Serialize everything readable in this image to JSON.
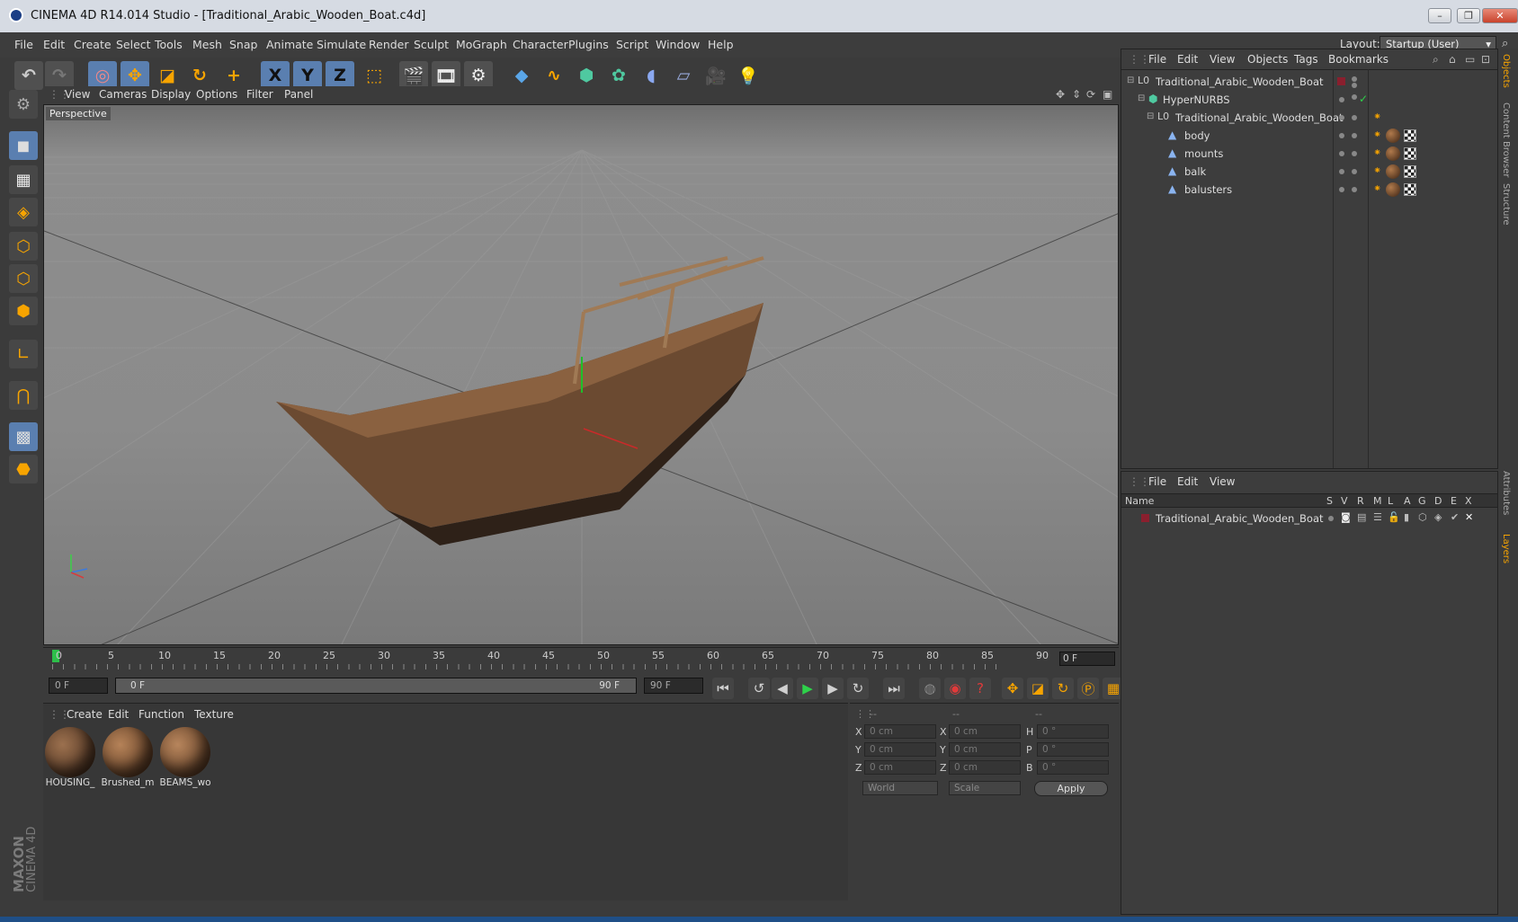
{
  "window": {
    "title": "CINEMA 4D R14.014 Studio - [Traditional_Arabic_Wooden_Boat.c4d]",
    "controls": {
      "minimize": "–",
      "restore": "❐",
      "close": "✕"
    }
  },
  "menubar": {
    "items": [
      "File",
      "Edit",
      "Create",
      "Select",
      "Tools",
      "Mesh",
      "Snap",
      "Animate",
      "Simulate",
      "Render",
      "Sculpt",
      "MoGraph",
      "Character",
      "Plugins",
      "Script",
      "Window",
      "Help"
    ],
    "layout_label": "Layout:",
    "layout_value": "Startup (User)"
  },
  "toolbar": {
    "icons": [
      "undo-icon",
      "redo-icon",
      "live-selection-icon",
      "move-icon",
      "scale-icon",
      "rotate-icon",
      "add-icon",
      "x-axis-icon",
      "y-axis-icon",
      "z-axis-icon",
      "world-coordinates-icon",
      "render-view-icon",
      "render-picture-viewer-icon",
      "edit-render-settings-icon",
      "cube-icon",
      "spline-icon",
      "nurbs-icon",
      "array-icon",
      "deformer-icon",
      "floor-icon",
      "camera-icon",
      "light-icon"
    ],
    "axis_labels": {
      "x": "X",
      "y": "Y",
      "z": "Z"
    }
  },
  "viewport": {
    "menu": [
      "View",
      "Cameras",
      "Display",
      "Options",
      "Filter",
      "Panel"
    ],
    "label": "Perspective"
  },
  "timeline": {
    "ticks": [
      "0",
      "5",
      "10",
      "15",
      "20",
      "25",
      "30",
      "35",
      "40",
      "45",
      "50",
      "55",
      "60",
      "65",
      "70",
      "75",
      "80",
      "85",
      "90"
    ],
    "current_frame": "0 F",
    "start_field": "0 F",
    "range_start": "0 F",
    "range_end": "90 F",
    "end_field": "90 F"
  },
  "material_manager": {
    "menu": [
      "Create",
      "Edit",
      "Function",
      "Texture"
    ],
    "materials": [
      {
        "name": "HOUSING_",
        "color": "#6b4a33"
      },
      {
        "name": "Brushed_m",
        "color": "#8a5a36"
      },
      {
        "name": "BEAMS_wo",
        "color": "#8d5d3a"
      }
    ]
  },
  "coordinates": {
    "headers": [
      "--",
      "--",
      "--"
    ],
    "rows": [
      {
        "l1": "X",
        "v1": "0 cm",
        "l2": "X",
        "v2": "0 cm",
        "l3": "H",
        "v3": "0 °"
      },
      {
        "l1": "Y",
        "v1": "0 cm",
        "l2": "Y",
        "v2": "0 cm",
        "l3": "P",
        "v3": "0 °"
      },
      {
        "l1": "Z",
        "v1": "0 cm",
        "l2": "Z",
        "v2": "0 cm",
        "l3": "B",
        "v3": "0 °"
      }
    ],
    "world": "World",
    "scale": "Scale",
    "apply": "Apply"
  },
  "object_manager": {
    "menu": [
      "File",
      "Edit",
      "View",
      "Objects",
      "Tags",
      "Bookmarks"
    ],
    "objects": [
      {
        "name": "Traditional_Arabic_Wooden_Boat",
        "icon": "null-object-icon",
        "tags": "layer"
      },
      {
        "name": "HyperNURBS",
        "icon": "hypernurbs-icon",
        "tags": "check"
      },
      {
        "name": "Traditional_Arabic_Wooden_Boat",
        "icon": "null-object-icon",
        "tags": "phong"
      },
      {
        "name": "body",
        "icon": "polygon-object-icon",
        "tags": "material"
      },
      {
        "name": "mounts",
        "icon": "polygon-object-icon",
        "tags": "material"
      },
      {
        "name": "balk",
        "icon": "polygon-object-icon",
        "tags": "material"
      },
      {
        "name": "balusters",
        "icon": "polygon-object-icon",
        "tags": "material"
      }
    ]
  },
  "layer_manager": {
    "menu": [
      "File",
      "Edit",
      "View"
    ],
    "columns": [
      "Name",
      "S",
      "V",
      "R",
      "M",
      "L",
      "A",
      "G",
      "D",
      "E",
      "X"
    ],
    "layers": [
      {
        "name": "Traditional_Arabic_Wooden_Boat",
        "color": "#8a1f2e"
      }
    ]
  },
  "right_tabs": [
    "Objects",
    "Content Browser",
    "Structure",
    "Attributes",
    "Layers"
  ],
  "branding": {
    "maxon": "MAXON",
    "product": "CINEMA 4D"
  }
}
